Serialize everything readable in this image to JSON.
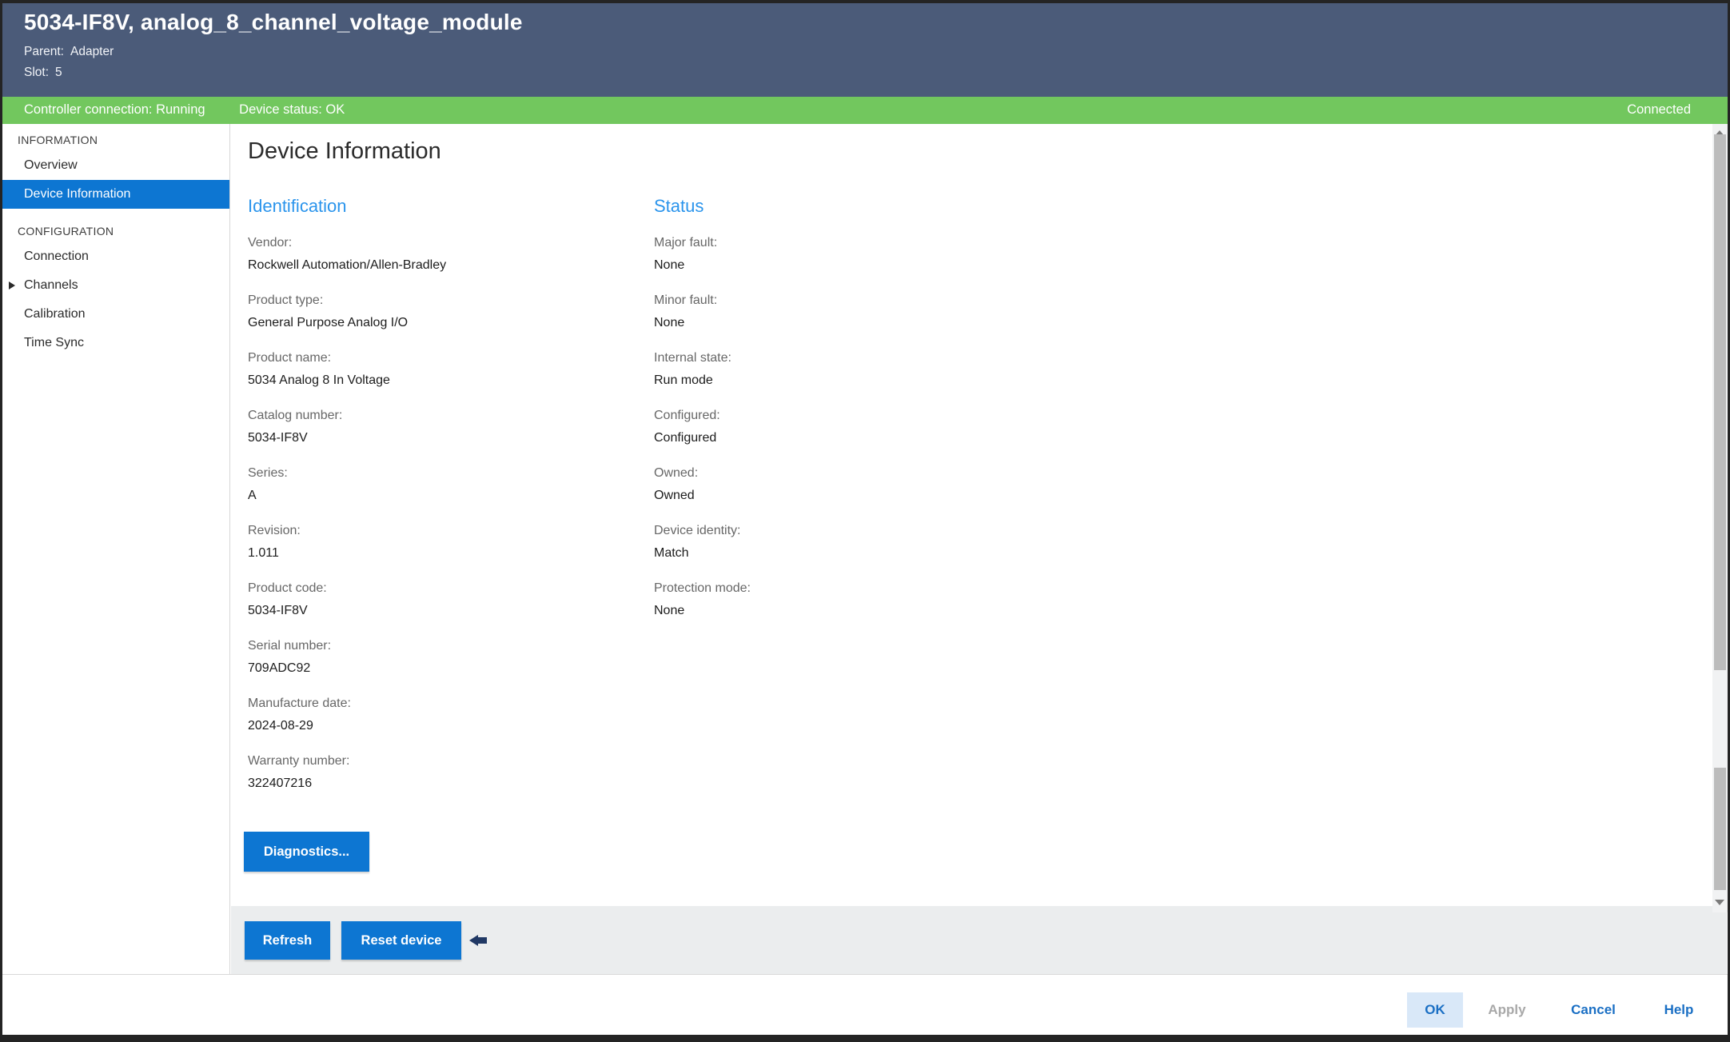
{
  "window": {
    "title": "5034-IF8V, analog_8_channel_voltage_module",
    "parent_label": "Parent:",
    "parent_value": "Adapter",
    "slot_label": "Slot:",
    "slot_value": "5"
  },
  "status_bar": {
    "controller_connection": "Controller connection: Running",
    "device_status": "Device status: OK",
    "connection_state": "Connected"
  },
  "sidebar": {
    "sections": [
      {
        "title": "INFORMATION",
        "items": [
          {
            "label": "Overview",
            "selected": false
          },
          {
            "label": "Device Information",
            "selected": true
          }
        ]
      },
      {
        "title": "CONFIGURATION",
        "items": [
          {
            "label": "Connection",
            "selected": false
          },
          {
            "label": "Channels",
            "selected": false,
            "expandable": true
          },
          {
            "label": "Calibration",
            "selected": false
          },
          {
            "label": "Time Sync",
            "selected": false
          }
        ]
      }
    ]
  },
  "main": {
    "title": "Device Information",
    "identification": {
      "heading": "Identification",
      "rows": [
        {
          "label": "Vendor:",
          "value": "Rockwell Automation/Allen-Bradley"
        },
        {
          "label": "Product type:",
          "value": "General Purpose Analog I/O"
        },
        {
          "label": "Product name:",
          "value": "5034 Analog 8 In Voltage"
        },
        {
          "label": "Catalog number:",
          "value": "5034-IF8V"
        },
        {
          "label": "Series:",
          "value": "A"
        },
        {
          "label": "Revision:",
          "value": "1.011"
        },
        {
          "label": "Product code:",
          "value": "5034-IF8V"
        },
        {
          "label": "Serial number:",
          "value": "709ADC92"
        },
        {
          "label": "Manufacture date:",
          "value": "2024-08-29"
        },
        {
          "label": "Warranty number:",
          "value": "322407216"
        }
      ]
    },
    "status": {
      "heading": "Status",
      "rows": [
        {
          "label": "Major fault:",
          "value": "None"
        },
        {
          "label": "Minor fault:",
          "value": "None"
        },
        {
          "label": "Internal state:",
          "value": "Run mode"
        },
        {
          "label": "Configured:",
          "value": "Configured"
        },
        {
          "label": "Owned:",
          "value": "Owned"
        },
        {
          "label": "Device identity:",
          "value": "Match"
        },
        {
          "label": "Protection mode:",
          "value": "None"
        }
      ]
    },
    "diagnostics_button": "Diagnostics..."
  },
  "actions": {
    "refresh_button": "Refresh",
    "reset_device_button": "Reset device",
    "arrow_icon": "left-arrow"
  },
  "footer": {
    "ok": "OK",
    "apply": "Apply",
    "cancel": "Cancel",
    "help": "Help"
  },
  "colors": {
    "header_bg": "#4b5b79",
    "status_green": "#72c75e",
    "accent_blue": "#0d76d2",
    "heading_blue": "#2a94ec",
    "link_blue": "#1a6fc4",
    "disabled_gray": "#a8a8a8",
    "action_strip_bg": "#ebedee"
  }
}
